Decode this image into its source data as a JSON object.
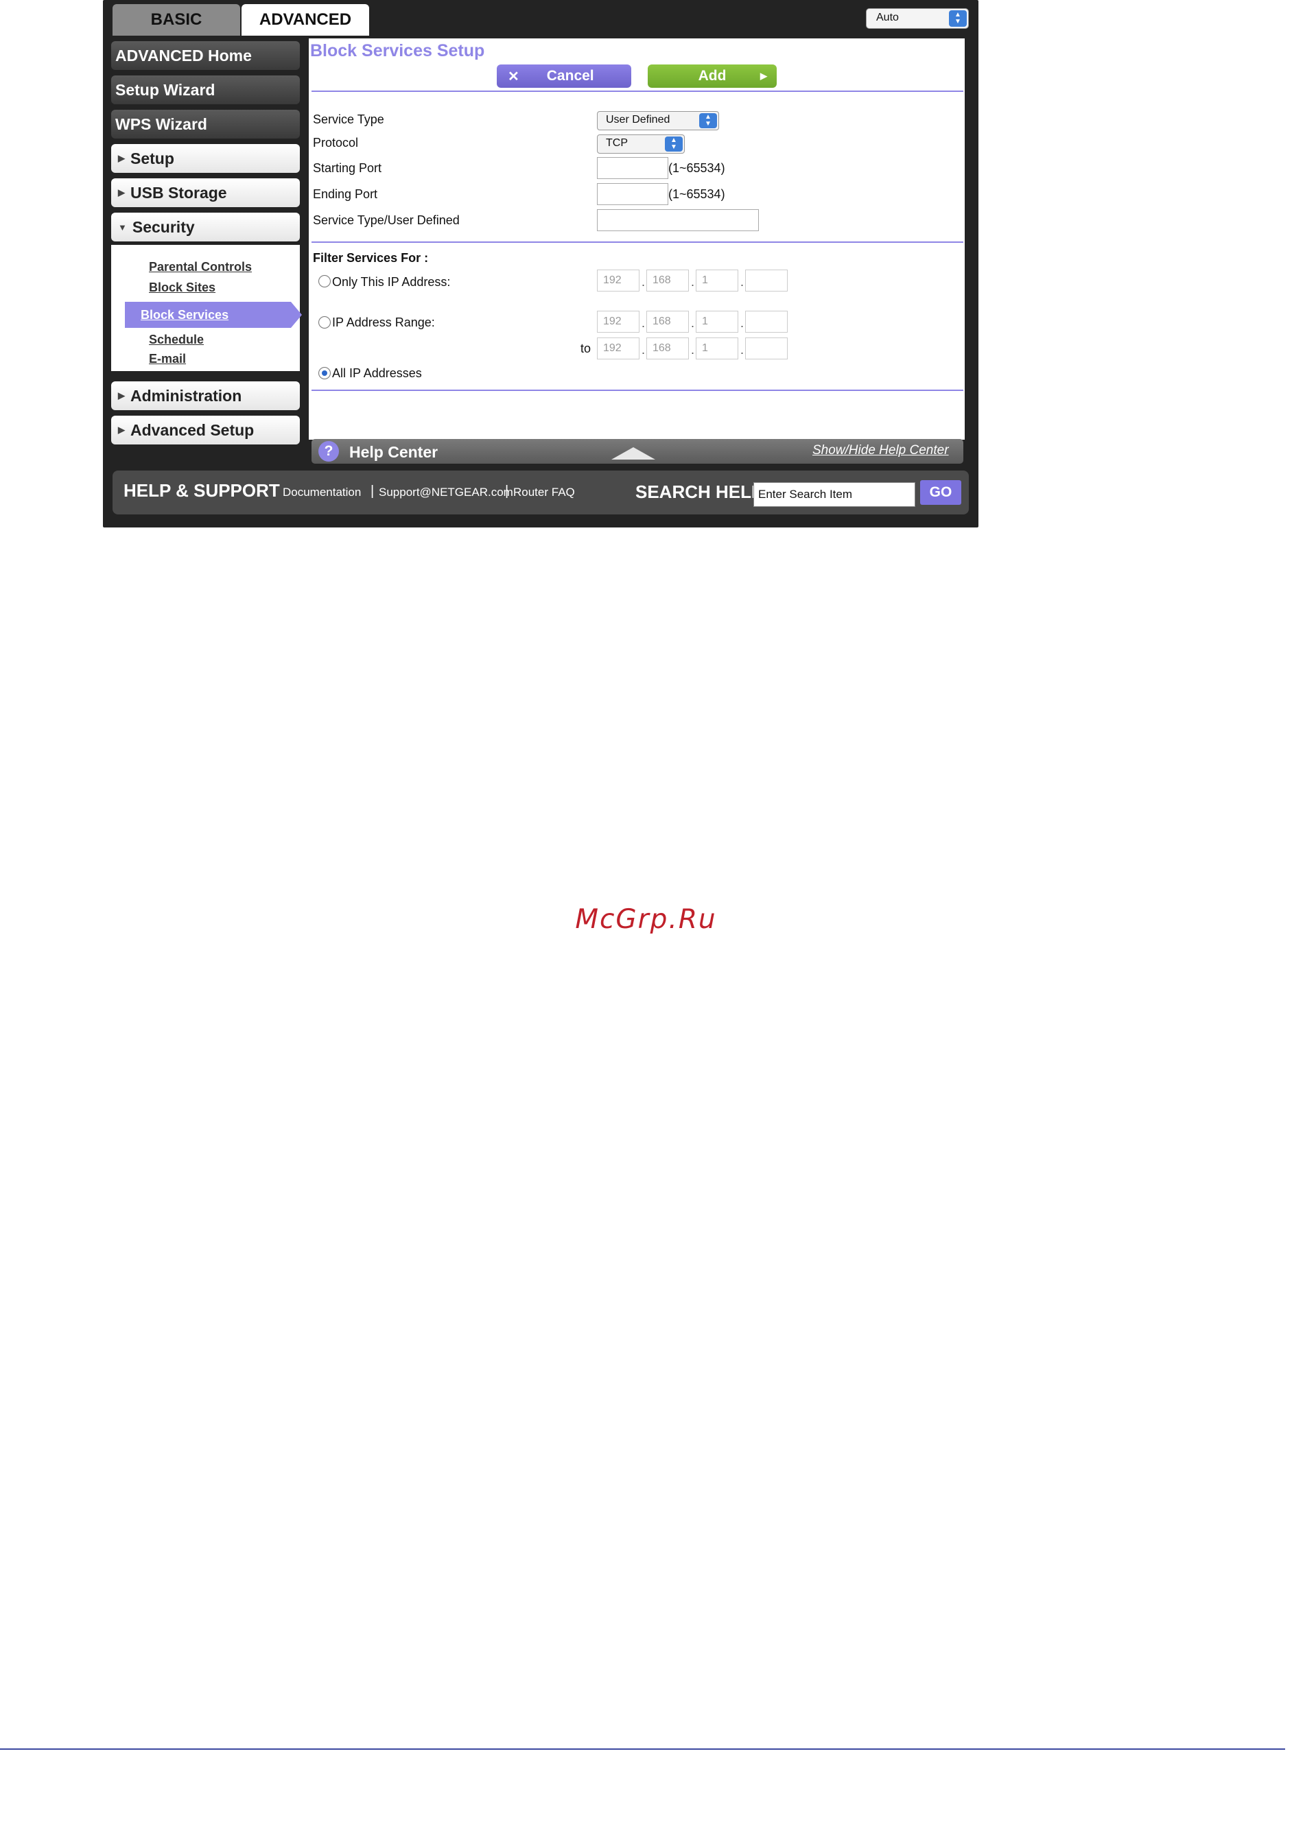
{
  "tabs": {
    "basic": "BASIC",
    "advanced": "ADVANCED"
  },
  "language_select": {
    "value": "Auto"
  },
  "sidebar": {
    "buttons": [
      "ADVANCED Home",
      "Setup Wizard",
      "WPS Wizard"
    ],
    "sections": {
      "setup": "Setup",
      "usb": "USB Storage",
      "security": "Security",
      "admin": "Administration",
      "advsetup": "Advanced Setup"
    },
    "security_items": {
      "parental": "Parental Controls",
      "block_sites": "Block Sites",
      "block_services": "Block Services",
      "schedule": "Schedule",
      "email": "E-mail"
    }
  },
  "main": {
    "title": "Block Services Setup",
    "cancel_label": "Cancel",
    "add_label": "Add",
    "service_type_label": "Service Type",
    "service_type_value": "User Defined",
    "protocol_label": "Protocol",
    "protocol_value": "TCP",
    "starting_port_label": "Starting Port",
    "ending_port_label": "Ending Port",
    "port_range_hint": "(1~65534)",
    "user_defined_label": "Service Type/User Defined",
    "filter_label": "Filter Services For :",
    "only_ip_label": "Only This IP Address:",
    "ip_range_label": "IP Address Range:",
    "to_label": "to",
    "all_ip_label": "All IP Addresses",
    "ip_octets": {
      "o1": "192",
      "o2": "168",
      "o3": "1"
    },
    "selected_filter": "All IP Addresses"
  },
  "help": {
    "title": "Help Center",
    "toggle": "Show/Hide Help Center"
  },
  "footer": {
    "help_support": "HELP & SUPPORT",
    "links": {
      "documentation": "Documentation",
      "support": "Support@NETGEAR.com",
      "faq": "Router FAQ"
    },
    "separator": "|",
    "search_help": "SEARCH HELP",
    "search_placeholder": "Enter Search Item",
    "go": "GO"
  },
  "watermark": "McGrp.Ru",
  "colors": {
    "accent": "#8f86e6",
    "add_green": "#8dc63f",
    "frame": "#232323",
    "watermark": "#c0202a"
  }
}
